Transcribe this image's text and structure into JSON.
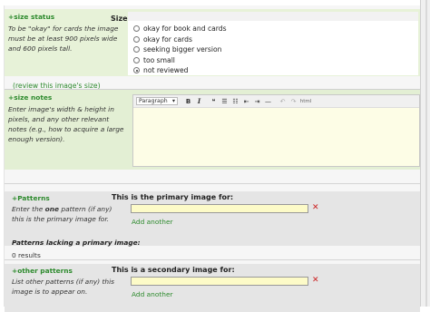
{
  "size_status": {
    "header": "+size status",
    "field_label": "Size:",
    "description": "To be \"okay\" for cards the image must be at least 900 pixels wide and 600 pixels tall.",
    "options": [
      {
        "label": "okay for book and cards",
        "selected": false
      },
      {
        "label": "okay for cards",
        "selected": false
      },
      {
        "label": "seeking bigger version",
        "selected": false
      },
      {
        "label": "too small",
        "selected": false
      },
      {
        "label": "not reviewed",
        "selected": true
      }
    ],
    "review_link": "(review this image's size)"
  },
  "size_notes": {
    "header": "+size notes",
    "description": "Enter image's width & height in pixels, and any other relevant notes (e.g., how to acquire a large enough version).",
    "editor": {
      "format_select": "Paragraph",
      "toolbar": [
        {
          "name": "bold-icon",
          "glyph": "B"
        },
        {
          "name": "italic-icon",
          "glyph": "I"
        },
        {
          "name": "blockquote-icon",
          "glyph": "❝"
        },
        {
          "name": "bulleted-list-icon",
          "glyph": "☰"
        },
        {
          "name": "numbered-list-icon",
          "glyph": "☷"
        },
        {
          "name": "outdent-icon",
          "glyph": "⇤"
        },
        {
          "name": "indent-icon",
          "glyph": "⇥"
        },
        {
          "name": "horizontal-rule-icon",
          "glyph": "—"
        },
        {
          "name": "undo-icon",
          "glyph": "↶"
        },
        {
          "name": "redo-icon",
          "glyph": "↷"
        },
        {
          "name": "html-icon",
          "glyph": "html"
        }
      ],
      "value": ""
    }
  },
  "patterns": {
    "header": "+Patterns",
    "field_label": "This is the primary image for:",
    "description": "Enter the one pattern (if any) this is the primary image for.",
    "add_another": "Add another",
    "lacking_label": "Patterns lacking a primary image:",
    "lacking_count": "0 results"
  },
  "other_patterns": {
    "header": "+other patterns",
    "field_label": "This is a secondary image for:",
    "description": "List other patterns (if any) this image is to appear on.",
    "add_another": "Add another"
  }
}
